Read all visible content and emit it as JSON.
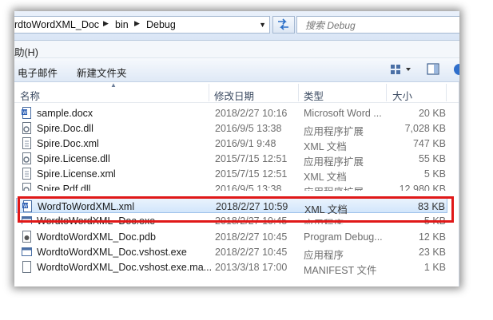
{
  "address_bar": {
    "crumbs": [
      "rdtoWordXML_Doc",
      "bin",
      "Debug"
    ],
    "search_placeholder": "搜索 Debug"
  },
  "menu": {
    "help_label": "助(H)"
  },
  "toolbar": {
    "email_label": "电子邮件",
    "new_folder_label": "新建文件夹"
  },
  "columns": {
    "name": "名称",
    "date": "修改日期",
    "type": "类型",
    "size": "大小"
  },
  "files": [
    {
      "name": "sample.docx",
      "date": "2018/2/27 10:16",
      "type": "Microsoft Word ...",
      "size": "20 KB",
      "icon": "word-doc-icon"
    },
    {
      "name": "Spire.Doc.dll",
      "date": "2016/9/5 13:38",
      "type": "应用程序扩展",
      "size": "7,028 KB",
      "icon": "dll-icon"
    },
    {
      "name": "Spire.Doc.xml",
      "date": "2016/9/1 9:48",
      "type": "XML 文档",
      "size": "747 KB",
      "icon": "xml-icon"
    },
    {
      "name": "Spire.License.dll",
      "date": "2015/7/15 12:51",
      "type": "应用程序扩展",
      "size": "55 KB",
      "icon": "dll-icon"
    },
    {
      "name": "Spire.License.xml",
      "date": "2015/7/15 12:51",
      "type": "XML 文档",
      "size": "5 KB",
      "icon": "xml-icon"
    },
    {
      "name": "Spire.Pdf.dll",
      "date": "2016/9/5 13:38",
      "type": "应用程序扩展",
      "size": "12,980 KB",
      "icon": "dll-icon"
    },
    {
      "name": "WordToWordXML.xml",
      "date": "2018/2/27 10:59",
      "type": "XML 文档",
      "size": "83 KB",
      "icon": "word-xml-icon",
      "selected": true
    },
    {
      "name": "WordtoWordXML_Doc.exe",
      "date": "2018/2/27 10:45",
      "type": "应用程序",
      "size": "5 KB",
      "icon": "exe-icon"
    },
    {
      "name": "WordtoWordXML_Doc.pdb",
      "date": "2018/2/27 10:45",
      "type": "Program Debug...",
      "size": "12 KB",
      "icon": "pdb-icon"
    },
    {
      "name": "WordtoWordXML_Doc.vshost.exe",
      "date": "2018/2/27 10:45",
      "type": "应用程序",
      "size": "23 KB",
      "icon": "exe-icon"
    },
    {
      "name": "WordtoWordXML_Doc.vshost.exe.ma...",
      "date": "2013/3/18 17:00",
      "type": "MANIFEST 文件",
      "size": "1 KB",
      "icon": "manifest-icon"
    }
  ],
  "highlight_color": "#e01818"
}
